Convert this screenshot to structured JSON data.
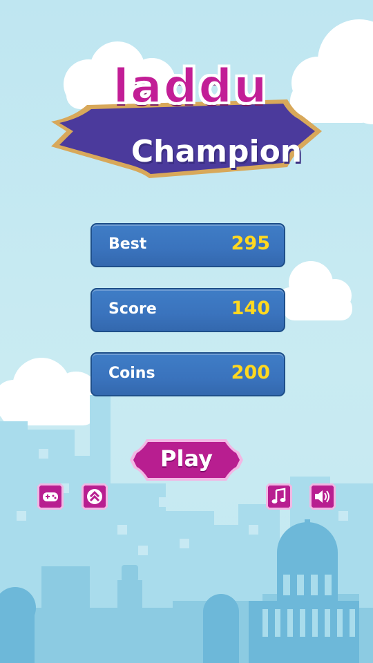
{
  "logo": {
    "line1": "laddu",
    "line2": "Champion"
  },
  "stats": [
    {
      "label": "Best",
      "value": "295"
    },
    {
      "label": "Score",
      "value": "140"
    },
    {
      "label": "Coins",
      "value": "200"
    }
  ],
  "play": {
    "label": "Play"
  },
  "icon_buttons": [
    {
      "icon": "gamepad-icon"
    },
    {
      "icon": "chevron-up-double-icon"
    },
    {
      "icon": "music-note-icon"
    },
    {
      "icon": "speaker-icon"
    }
  ],
  "colors": {
    "sky": "#c3e7f1",
    "magenta": "#c21e96",
    "panel_blue": "#3a73bd",
    "value_yellow": "#ffd820",
    "banner_purple": "#4b3a9c",
    "gold": "#d8a85a"
  }
}
